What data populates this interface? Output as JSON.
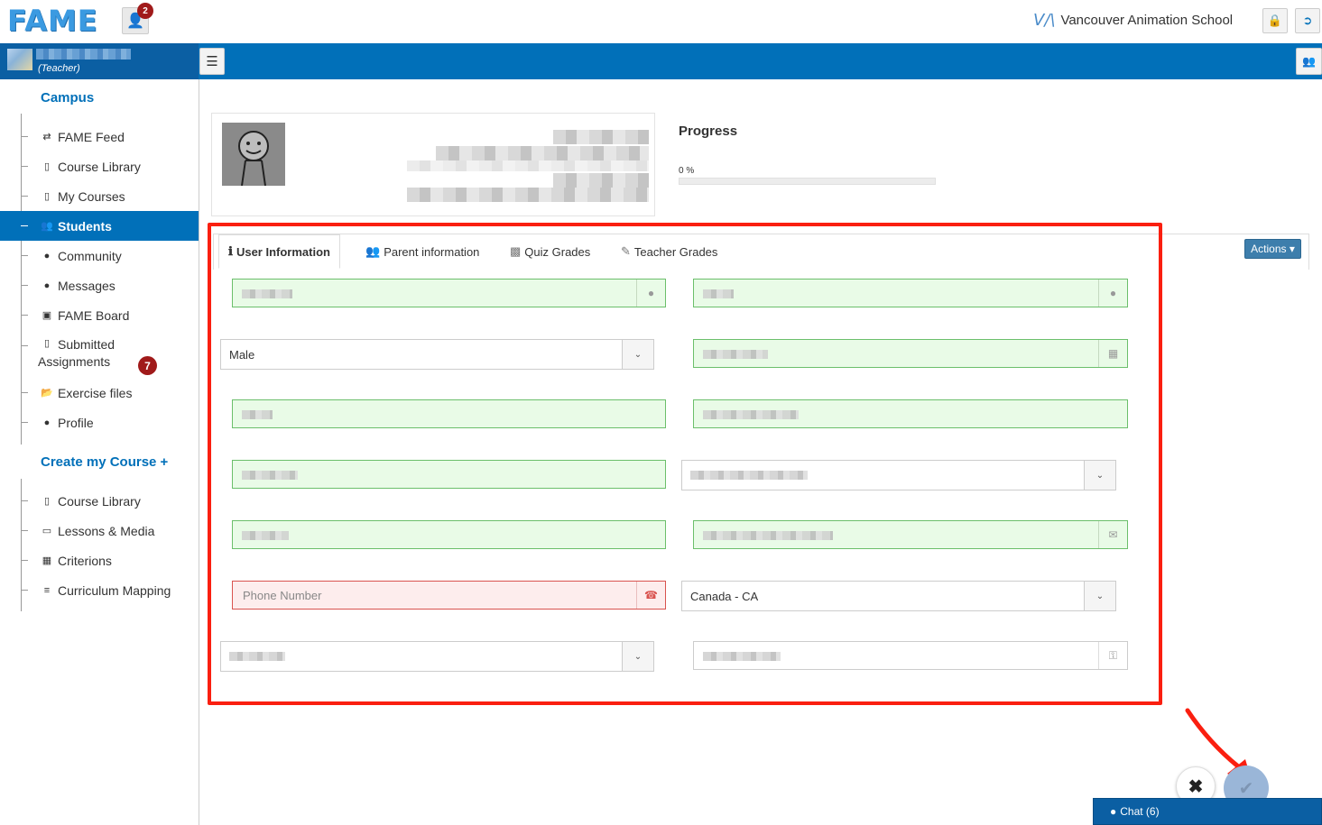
{
  "app": {
    "logo": "FAME",
    "notification_count": "2"
  },
  "header": {
    "school_logo": "V/\\",
    "school_name": "Vancouver Animation School"
  },
  "user": {
    "role": "(Teacher)"
  },
  "sidebar": {
    "campus_heading": "Campus",
    "campus_items": [
      {
        "label": "FAME Feed",
        "icon": "retweet-icon"
      },
      {
        "label": "Course Library",
        "icon": "book-icon"
      },
      {
        "label": "My Courses",
        "icon": "book-icon"
      },
      {
        "label": "Students",
        "icon": "users-icon",
        "active": true
      },
      {
        "label": "Community",
        "icon": "globe-icon"
      },
      {
        "label": "Messages",
        "icon": "comment-icon"
      },
      {
        "label": "FAME Board",
        "icon": "picture-icon"
      },
      {
        "label": "Submitted Assignments",
        "line1": "Submitted",
        "line2": "Assignments",
        "icon": "book-icon",
        "badge": "7"
      },
      {
        "label": "Exercise files",
        "icon": "folder-open-icon"
      },
      {
        "label": "Profile",
        "icon": "user-icon"
      }
    ],
    "create_heading": "Create my Course +",
    "create_items": [
      {
        "label": "Course Library",
        "icon": "book-icon"
      },
      {
        "label": "Lessons & Media",
        "icon": "monitor-icon"
      },
      {
        "label": "Criterions",
        "icon": "table-icon"
      },
      {
        "label": "Curriculum Mapping",
        "icon": "list-icon"
      }
    ]
  },
  "progress": {
    "title": "Progress",
    "value_text": "0  %",
    "percent": 0
  },
  "tabs": [
    {
      "label": "User Information",
      "icon": "info-icon",
      "active": true
    },
    {
      "label": "Parent information",
      "icon": "group-icon"
    },
    {
      "label": "Quiz Grades",
      "icon": "cubes-icon"
    },
    {
      "label": "Teacher Grades",
      "icon": "edit-icon"
    }
  ],
  "actions_label": "Actions ▾",
  "form": {
    "gender_value": "Male",
    "phone_placeholder": "Phone Number",
    "country_value": "Canada - CA"
  },
  "chat_label": "Chat (6)",
  "colors": {
    "primary": "#0170b9",
    "valid_bg": "#e9fbe7",
    "error_bg": "#fdeded",
    "badge": "#a01a1a",
    "highlight": "#fa1f10"
  }
}
